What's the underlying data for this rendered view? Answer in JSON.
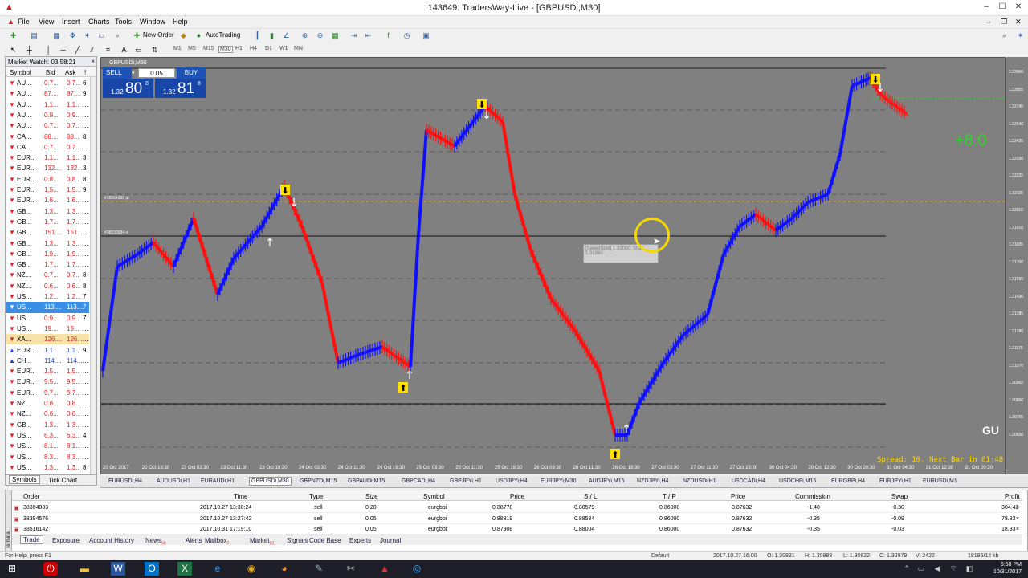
{
  "window": {
    "title": "143649: TradersWay-Live - [GBPUSDi,M30]",
    "min": "–",
    "max": "☐",
    "close": "✕"
  },
  "menu": [
    "File",
    "View",
    "Insert",
    "Charts",
    "Tools",
    "Window",
    "Help"
  ],
  "toolbar": {
    "new_order": "New Order",
    "auto_trading": "AutoTrading",
    "timeframes": [
      "M1",
      "M5",
      "M15",
      "M30",
      "H1",
      "H4",
      "D1",
      "W1",
      "MN"
    ]
  },
  "market_watch": {
    "title": "Market Watch: 03:58:21",
    "close": "×",
    "columns": {
      "symbol": "Symbol",
      "bid": "Bid",
      "ask": "Ask",
      "spread": "!"
    },
    "rows": [
      {
        "dir": "dn",
        "symbol": "AU...",
        "bid": "0.7...",
        "ask": "0.7...",
        "spread": "6"
      },
      {
        "dir": "dn",
        "symbol": "AU...",
        "bid": "87....",
        "ask": "87....",
        "spread": "9"
      },
      {
        "dir": "dn",
        "symbol": "AU...",
        "bid": "1.1...",
        "ask": "1.1...",
        "spread": "..."
      },
      {
        "dir": "dn",
        "symbol": "AU...",
        "bid": "0.9...",
        "ask": "0.9...",
        "spread": "..."
      },
      {
        "dir": "dn",
        "symbol": "AU...",
        "bid": "0.7...",
        "ask": "0.7...",
        "spread": "..."
      },
      {
        "dir": "dn",
        "symbol": "CA...",
        "bid": "88....",
        "ask": "88....",
        "spread": "8"
      },
      {
        "dir": "dn",
        "symbol": "CA...",
        "bid": "0.7...",
        "ask": "0.7...",
        "spread": "..."
      },
      {
        "dir": "dn",
        "symbol": "EUR...",
        "bid": "1.1...",
        "ask": "1.1...",
        "spread": "3"
      },
      {
        "dir": "dn",
        "symbol": "EUR...",
        "bid": "132....",
        "ask": "132....",
        "spread": "3"
      },
      {
        "dir": "dn",
        "symbol": "EUR...",
        "bid": "0.8...",
        "ask": "0.8...",
        "spread": "8"
      },
      {
        "dir": "dn",
        "symbol": "EUR...",
        "bid": "1.5...",
        "ask": "1.5...",
        "spread": "9"
      },
      {
        "dir": "dn",
        "symbol": "EUR...",
        "bid": "1.6...",
        "ask": "1.6...",
        "spread": "..."
      },
      {
        "dir": "dn",
        "symbol": "GB...",
        "bid": "1.3...",
        "ask": "1.3...",
        "spread": "..."
      },
      {
        "dir": "dn",
        "symbol": "GB...",
        "bid": "1.7...",
        "ask": "1.7...",
        "spread": "..."
      },
      {
        "dir": "dn",
        "symbol": "GB...",
        "bid": "151....",
        "ask": "151....",
        "spread": "..."
      },
      {
        "dir": "dn",
        "symbol": "GB...",
        "bid": "1.3...",
        "ask": "1.3...",
        "spread": "..."
      },
      {
        "dir": "dn",
        "symbol": "GB...",
        "bid": "1.9...",
        "ask": "1.9...",
        "spread": "..."
      },
      {
        "dir": "dn",
        "symbol": "GB...",
        "bid": "1.7...",
        "ask": "1.7...",
        "spread": "..."
      },
      {
        "dir": "dn",
        "symbol": "NZ...",
        "bid": "0.7...",
        "ask": "0.7...",
        "spread": "8"
      },
      {
        "dir": "dn",
        "symbol": "NZ...",
        "bid": "0.6...",
        "ask": "0.6...",
        "spread": "8"
      },
      {
        "dir": "dn",
        "symbol": "US...",
        "bid": "1.2...",
        "ask": "1.2...",
        "spread": "7"
      },
      {
        "dir": "dn",
        "symbol": "US...",
        "bid": "113....",
        "ask": "113....",
        "spread": "7",
        "sel": true
      },
      {
        "dir": "dn",
        "symbol": "US...",
        "bid": "0.9...",
        "ask": "0.9...",
        "spread": "7"
      },
      {
        "dir": "dn",
        "symbol": "US...",
        "bid": "19....",
        "ask": "19....",
        "spread": "..."
      },
      {
        "dir": "dn",
        "symbol": "XA...",
        "bid": "126....",
        "ask": "126....",
        "spread": "...",
        "hl": true
      },
      {
        "dir": "up",
        "symbol": "EUR...",
        "bid": "1.1...",
        "ask": "1.1...",
        "spread": "9"
      },
      {
        "dir": "up",
        "symbol": "CH...",
        "bid": "114....",
        "ask": "114....",
        "spread": "..."
      },
      {
        "dir": "dn",
        "symbol": "EUR...",
        "bid": "1.5...",
        "ask": "1.5...",
        "spread": "..."
      },
      {
        "dir": "dn",
        "symbol": "EUR...",
        "bid": "9.5...",
        "ask": "9.5...",
        "spread": "..."
      },
      {
        "dir": "dn",
        "symbol": "EUR...",
        "bid": "9.7...",
        "ask": "9.7...",
        "spread": "..."
      },
      {
        "dir": "dn",
        "symbol": "NZ...",
        "bid": "0.8...",
        "ask": "0.8...",
        "spread": "..."
      },
      {
        "dir": "dn",
        "symbol": "NZ...",
        "bid": "0.6...",
        "ask": "0.6...",
        "spread": "..."
      },
      {
        "dir": "dn",
        "symbol": "GB...",
        "bid": "1.3...",
        "ask": "1.3...",
        "spread": "..."
      },
      {
        "dir": "dn",
        "symbol": "US...",
        "bid": "6.3...",
        "ask": "6.3...",
        "spread": "4"
      },
      {
        "dir": "dn",
        "symbol": "US...",
        "bid": "8.1...",
        "ask": "8.1...",
        "spread": "..."
      },
      {
        "dir": "dn",
        "symbol": "US...",
        "bid": "8.3...",
        "ask": "8.3...",
        "spread": "..."
      },
      {
        "dir": "dn",
        "symbol": "US...",
        "bid": "1.3...",
        "ask": "1.3...",
        "spread": "8"
      }
    ],
    "tabs": [
      "Symbols",
      "Tick Chart"
    ]
  },
  "chart": {
    "label": "GBPUSDi,M30",
    "sell": "SELL",
    "buy": "BUY",
    "lot": "0.05",
    "sell_quote": {
      "small": "1.32",
      "big": "80",
      "sup": "8"
    },
    "buy_quote": {
      "small": "1.32",
      "big": "81",
      "sup": "8"
    },
    "profit": "+8.0",
    "symbol_tag": "GU",
    "spread_info": "Spread: 10. Next Bar in 01:48",
    "tp_label": "#38564298 tp",
    "sl_label": "#38532684 sl",
    "tooltip": "[SweetSpot] 1.32000, Stop 1.31960",
    "bull_color": "#1010ff",
    "bear_color": "#ff1010",
    "price_axis": [
      "1.32960",
      "1.32855",
      "1.32745",
      "1.32640",
      "1.32435",
      "1.32330",
      "1.32225",
      "1.32120",
      "1.32015",
      "1.31910",
      "1.31805",
      "1.31700",
      "1.31595",
      "1.31490",
      "1.31385",
      "1.31280",
      "1.31175",
      "1.31070",
      "1.30965",
      "1.30860",
      "1.30755",
      "1.30650"
    ],
    "time_axis": [
      "20 Oct 2017",
      "20 Oct 18:30",
      "23 Oct 03:30",
      "23 Oct 11:30",
      "23 Oct 19:30",
      "24 Oct 03:30",
      "24 Oct 11:30",
      "24 Oct 19:30",
      "25 Oct 03:30",
      "25 Oct 11:30",
      "25 Oct 19:30",
      "26 Oct 03:30",
      "26 Oct 11:30",
      "26 Oct 19:30",
      "27 Oct 03:30",
      "27 Oct 11:30",
      "27 Oct 19:30",
      "30 Oct 04:30",
      "30 Oct 12:30",
      "30 Oct 20:30",
      "31 Oct 04:30",
      "31 Oct 12:30",
      "31 Oct 20:30"
    ]
  },
  "chart_tabs": [
    "EURUSDi,H4",
    "AUDUSDi,H1",
    "EURAUDi,H1",
    "GBPUSDi,M30",
    "GBPNZDi,M15",
    "GBPAUDi,M15",
    "GBPCADi,H4",
    "GBPJPYi,H1",
    "USDJPYi,H4",
    "EURJPYi,M30",
    "AUDJPYi,M15",
    "NZDJPYi,H4",
    "NZDUSDi,H1",
    "USDCADi,H4",
    "USDCHFi,M15",
    "EURGBPi,H4",
    "EURJPYi,H1",
    "EURUSDi,M1"
  ],
  "terminal": {
    "columns": [
      "Order",
      "Time",
      "Type",
      "Size",
      "Symbol",
      "Price",
      "S / L",
      "T / P",
      "Price",
      "Commission",
      "Swap",
      "Profit"
    ],
    "rows": [
      [
        "38364883",
        "2017.10.27 13:30:24",
        "sell",
        "0.20",
        "eurgbpi",
        "0.88778",
        "0.88579",
        "0.86000",
        "0.87632",
        "-1.40",
        "-0.30",
        "304.42"
      ],
      [
        "38394576",
        "2017.10.27 13:27:42",
        "sell",
        "0.05",
        "eurgbpi",
        "0.88819",
        "0.88584",
        "0.86000",
        "0.87632",
        "-0.35",
        "-0.09",
        "78.83"
      ],
      [
        "38516142",
        "2017.10.31 17:19:10",
        "sell",
        "0.05",
        "eurgbpi",
        "0.87908",
        "0.88004",
        "0.86000",
        "0.87632",
        "-0.35",
        "-0.03",
        "18.33"
      ]
    ],
    "tabs": [
      "Trade",
      "Exposure",
      "Account History",
      "News",
      "Alerts",
      "Mailbox",
      "Market",
      "Signals",
      "Code Base",
      "Experts",
      "Journal"
    ],
    "news_badge": "99",
    "mailbox_badge": "7",
    "market_badge": "59",
    "side_label": "Terminal"
  },
  "status": {
    "help": "For Help, press F1",
    "profile": "Default",
    "bar_time": "2017.10.27 16:00",
    "open": "O: 1.30831",
    "high": "H: 1.30988",
    "low": "L: 1.30822",
    "close": "C: 1.30979",
    "volume": "V: 2422",
    "traffic": "18185/12 kb"
  },
  "taskbar": {
    "time": "6:58 PM",
    "date": "10/31/2017"
  }
}
